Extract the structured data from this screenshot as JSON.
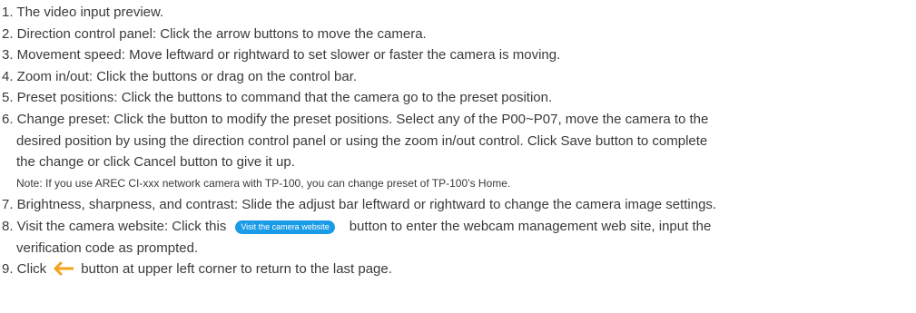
{
  "items": [
    "1. The video input preview.",
    "2. Direction control panel: Click the arrow buttons to move the camera.",
    "3. Movement speed: Move leftward or rightward to set slower or faster the camera is moving.",
    "4. Zoom in/out: Click the buttons or drag on the control bar.",
    "5. Preset positions: Click the buttons to command that the camera go to the preset position."
  ],
  "item6": {
    "line1": "6. Change preset: Click the button to modify the preset positions. Select any of the P00~P07, move the camera to the",
    "line2": "desired position by using the direction control panel or using the zoom in/out control. Click Save button to complete",
    "line3": "the change or click Cancel button to give it up.",
    "note": "Note: If you use AREC CI-xxx network camera with TP-100, you can change preset of TP-100’s Home."
  },
  "item7": "7. Brightness, sharpness, and contrast: Slide the adjust bar leftward or rightward to change the camera image settings.",
  "item8": {
    "before": "8. Visit the camera website: Click this",
    "button_label": "Visit the camera website",
    "after": "button to enter the webcam management web site, input the",
    "line2": "verification code as prompted."
  },
  "item9": {
    "before": "9. Click",
    "icon": "back-arrow-icon",
    "after": "button at upper left corner to return to the last page."
  },
  "colors": {
    "text": "#3a3a3a",
    "button": "#1a9be8",
    "arrow": "#f5a21b"
  }
}
